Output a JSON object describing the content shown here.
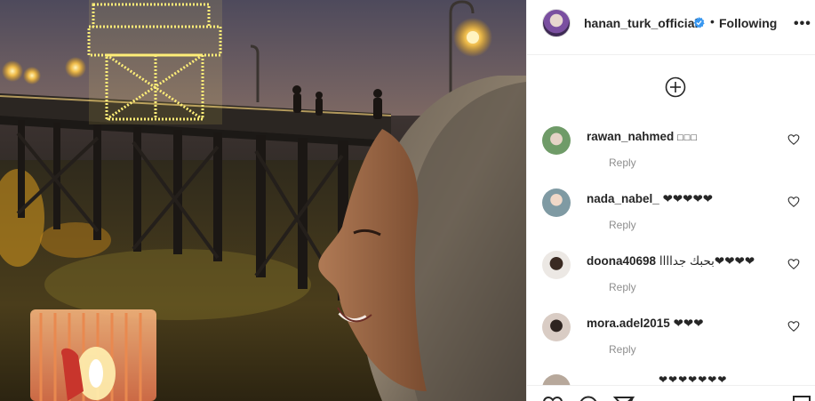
{
  "post": {
    "username": "hanan_turk_official",
    "dot": "•",
    "follow_state": "Following",
    "more_label": "•••"
  },
  "comments": [
    {
      "username": "rawan_nahmed",
      "text": "",
      "reply": "Reply",
      "avatar_color": "#7da17a"
    },
    {
      "username": "nada_nabel_",
      "text": "❤❤❤❤❤",
      "reply": "Reply",
      "avatar_color": "#7f9aa3"
    },
    {
      "username": "doona40698",
      "text": "بحبك جداااا❤❤❤❤",
      "reply": "Reply",
      "avatar_color": "#d9d4d0"
    },
    {
      "username": "mora.adel2015",
      "text": "❤❤❤",
      "reply": "Reply",
      "avatar_color": "#c8b8b0"
    }
  ],
  "partial_comment_text": "❤❤❤❤❤❤❤",
  "icons": {
    "verified": "verified-badge-icon",
    "load_more": "plus-circle-icon",
    "heart": "heart-icon",
    "more": "more-options-icon"
  },
  "colors": {
    "verified": "#3897f0",
    "secondary_text": "#8e8e8e",
    "divider": "#efefef"
  }
}
